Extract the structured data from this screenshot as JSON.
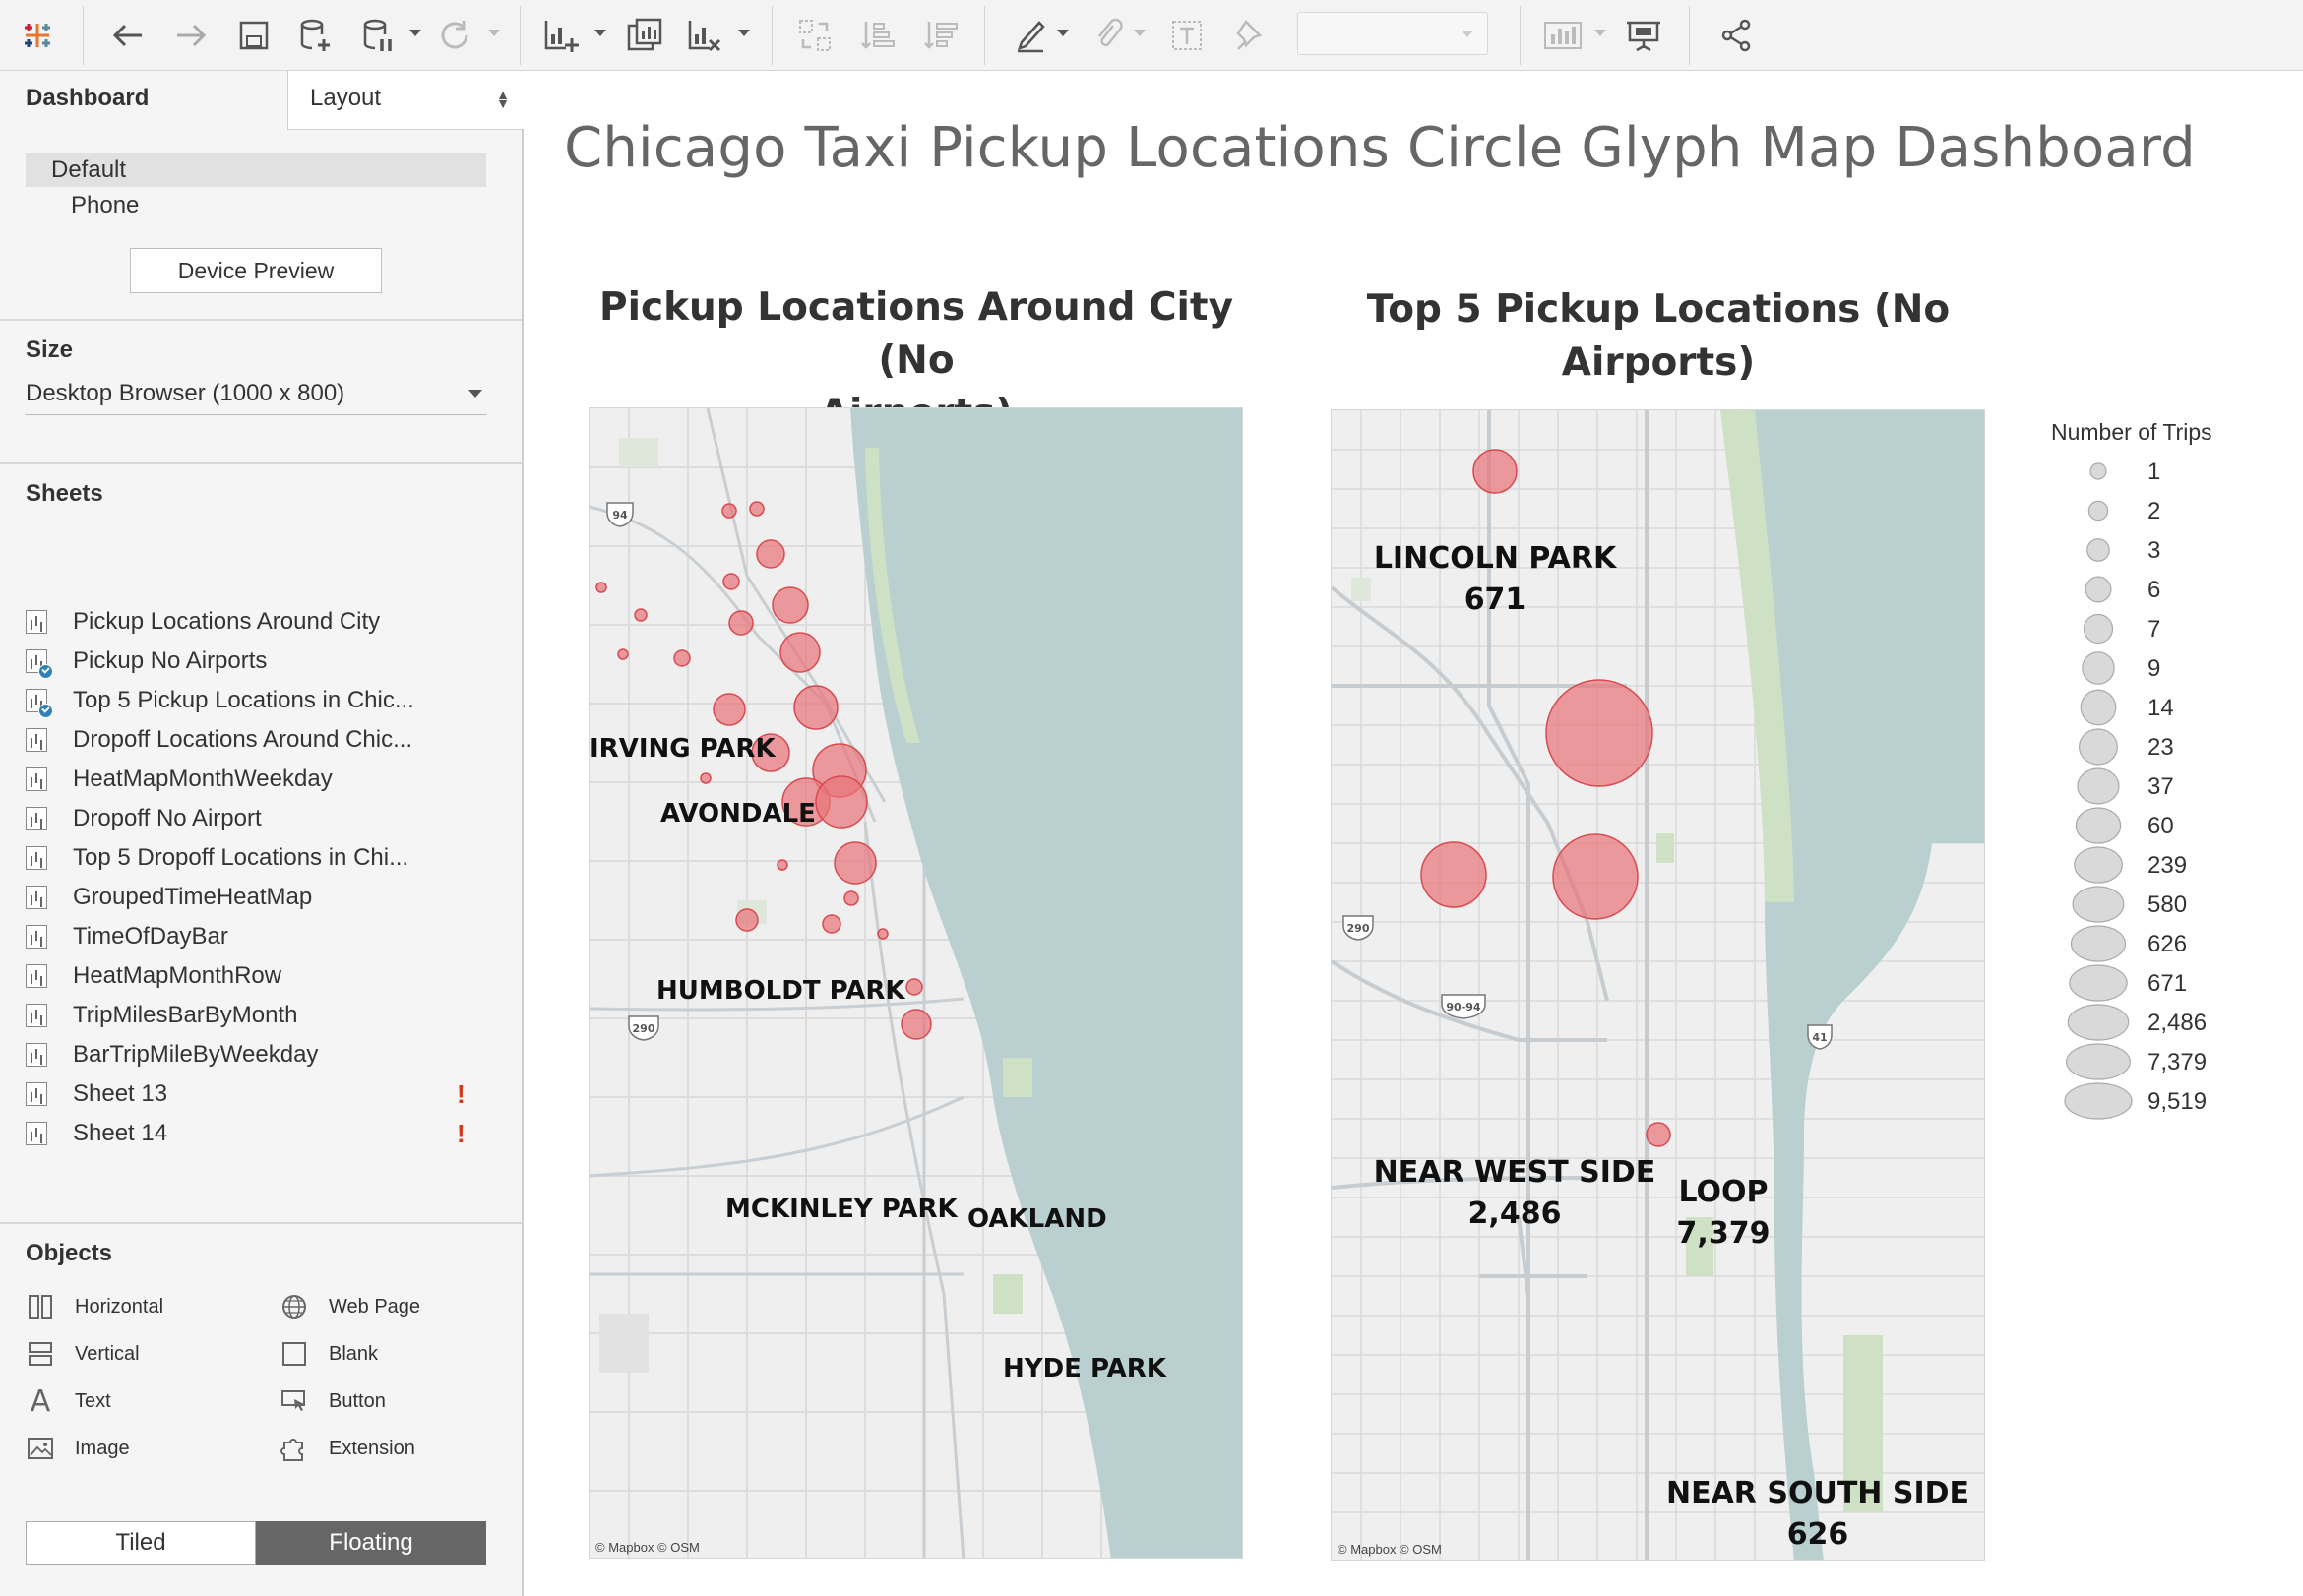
{
  "toolbar": {
    "icons": [
      "tableau-logo-icon",
      "undo-icon",
      "redo-icon",
      "save-icon",
      "new-data-source-icon",
      "pause-auto-updates-icon",
      "refresh-icon",
      "new-worksheet-icon",
      "duplicate-sheet-icon",
      "clear-sheet-icon",
      "swap-axes-icon",
      "sort-ascending-icon",
      "sort-descending-icon",
      "highlight-icon",
      "group-members-icon",
      "show-mark-labels-icon",
      "fix-axes-icon",
      "fit-dropdown",
      "show-me-icon",
      "presentation-mode-icon",
      "share-icon"
    ]
  },
  "left_pane": {
    "tabs": {
      "dashboard": "Dashboard",
      "layout": "Layout"
    },
    "devices": {
      "default": "Default",
      "phone": "Phone"
    },
    "device_preview_label": "Device Preview",
    "size": {
      "title": "Size",
      "value": "Desktop Browser (1000 x 800)"
    },
    "sheets": {
      "title": "Sheets",
      "items": [
        {
          "label": "Pickup Locations Around City",
          "in_use": false,
          "warning": false
        },
        {
          "label": "Pickup No Airports",
          "in_use": true,
          "warning": false
        },
        {
          "label": "Top 5 Pickup Locations in Chic...",
          "in_use": true,
          "warning": false
        },
        {
          "label": "Dropoff Locations Around Chic...",
          "in_use": false,
          "warning": false
        },
        {
          "label": "HeatMapMonthWeekday",
          "in_use": false,
          "warning": false
        },
        {
          "label": "Dropoff No Airport",
          "in_use": false,
          "warning": false
        },
        {
          "label": "Top 5 Dropoff Locations in Chi...",
          "in_use": false,
          "warning": false
        },
        {
          "label": "GroupedTimeHeatMap",
          "in_use": false,
          "warning": false
        },
        {
          "label": "TimeOfDayBar",
          "in_use": false,
          "warning": false
        },
        {
          "label": "HeatMapMonthRow",
          "in_use": false,
          "warning": false
        },
        {
          "label": "TripMilesBarByMonth",
          "in_use": false,
          "warning": false
        },
        {
          "label": "BarTripMileByWeekday",
          "in_use": false,
          "warning": false
        },
        {
          "label": "Sheet 13",
          "in_use": false,
          "warning": true
        },
        {
          "label": "Sheet 14",
          "in_use": false,
          "warning": true
        }
      ],
      "warning_mark": "!"
    },
    "objects": {
      "title": "Objects",
      "items": [
        {
          "label": "Horizontal",
          "icon": "horizontal-icon"
        },
        {
          "label": "Web Page",
          "icon": "globe-icon"
        },
        {
          "label": "Vertical",
          "icon": "vertical-icon"
        },
        {
          "label": "Blank",
          "icon": "blank-icon"
        },
        {
          "label": "Text",
          "icon": "text-icon"
        },
        {
          "label": "Button",
          "icon": "button-icon"
        },
        {
          "label": "Image",
          "icon": "image-icon"
        },
        {
          "label": "Extension",
          "icon": "extension-icon"
        }
      ]
    },
    "layout_mode": {
      "tiled": "Tiled",
      "floating": "Floating",
      "selected": "Floating"
    }
  },
  "dashboard": {
    "title": "Chicago Taxi Pickup Locations Circle Glyph Map Dashboard",
    "map_left": {
      "title_line1": "Pickup Locations Around City (No",
      "title_line2": "Airports)",
      "attribution": "© Mapbox © OSM",
      "labels": [
        "IRVING PARK",
        "AVONDALE",
        "HUMBOLDT PARK",
        "MCKINLEY PARK",
        "OAKLAND",
        "HYDE PARK"
      ],
      "highway_shields": [
        "94",
        "290"
      ]
    },
    "map_right": {
      "title_line1": "Top 5 Pickup Locations (No",
      "title_line2": "Airports)",
      "attribution": "© Mapbox © OSM",
      "locations": [
        {
          "name": "LINCOLN PARK",
          "trips": "671"
        },
        {
          "name": "NEAR WEST SIDE",
          "trips": "2,486"
        },
        {
          "name": "LOOP",
          "trips": "7,379"
        },
        {
          "name": "NEAR SOUTH SIDE",
          "trips": "626"
        }
      ],
      "highway_shields": [
        "290",
        "90-94",
        "41"
      ]
    },
    "legend": {
      "title": "Number of Trips",
      "values": [
        "1",
        "2",
        "3",
        "6",
        "7",
        "9",
        "14",
        "23",
        "37",
        "60",
        "239",
        "580",
        "626",
        "671",
        "2,486",
        "7,379",
        "9,519"
      ]
    },
    "colors": {
      "circle_fill": "#e8767a",
      "circle_stroke": "#d94a50",
      "water": "#b9cfd0",
      "land": "#efefef",
      "park": "#cfe1c4",
      "legend_circle": "#d9d9d9"
    }
  }
}
